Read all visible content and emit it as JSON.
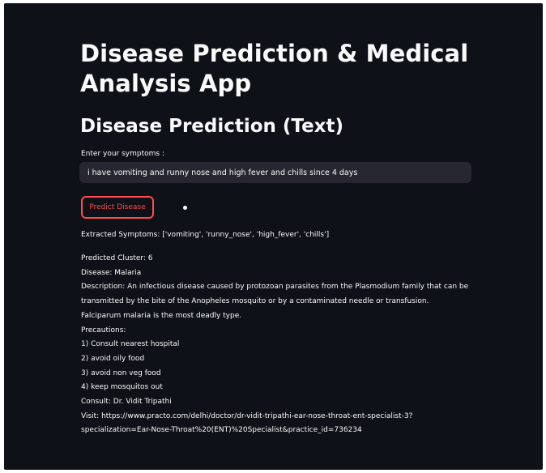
{
  "app": {
    "title": "Disease Prediction & Medical Analysis App"
  },
  "section": {
    "title": "Disease Prediction (Text)"
  },
  "symptoms_input": {
    "label": "Enter your symptoms :",
    "value": "i have vomiting and runny nose and high fever and chills since 4 days"
  },
  "predict_button": {
    "label": "Predict Disease"
  },
  "results": {
    "extracted": "Extracted Symptoms: ['vomiting', 'runny_nose', 'high_fever', 'chills']",
    "cluster": "Predicted Cluster: 6",
    "disease": "Disease: Malaria",
    "description_1": "Description: An infectious disease caused by protozoan parasites from the Plasmodium family that can be",
    "description_2": "transmitted by the bite of the Anopheles mosquito or by a contaminated needle or transfusion.",
    "description_3": "Falciparum malaria is the most deadly type.",
    "precautions_heading": "Precautions:",
    "precautions": [
      "1) Consult nearest hospital",
      "2) avoid oily food",
      "3) avoid non veg food",
      "4) keep mosquitos out"
    ],
    "consult": "Consult: Dr. Vidit Tripathi",
    "visit_1": "Visit: https://www.practo.com/delhi/doctor/dr-vidit-tripathi-ear-nose-throat-ent-specialist-3?",
    "visit_2": "specialization=Ear-Nose-Throat%20(ENT)%20Specialist&practice_id=736234"
  }
}
